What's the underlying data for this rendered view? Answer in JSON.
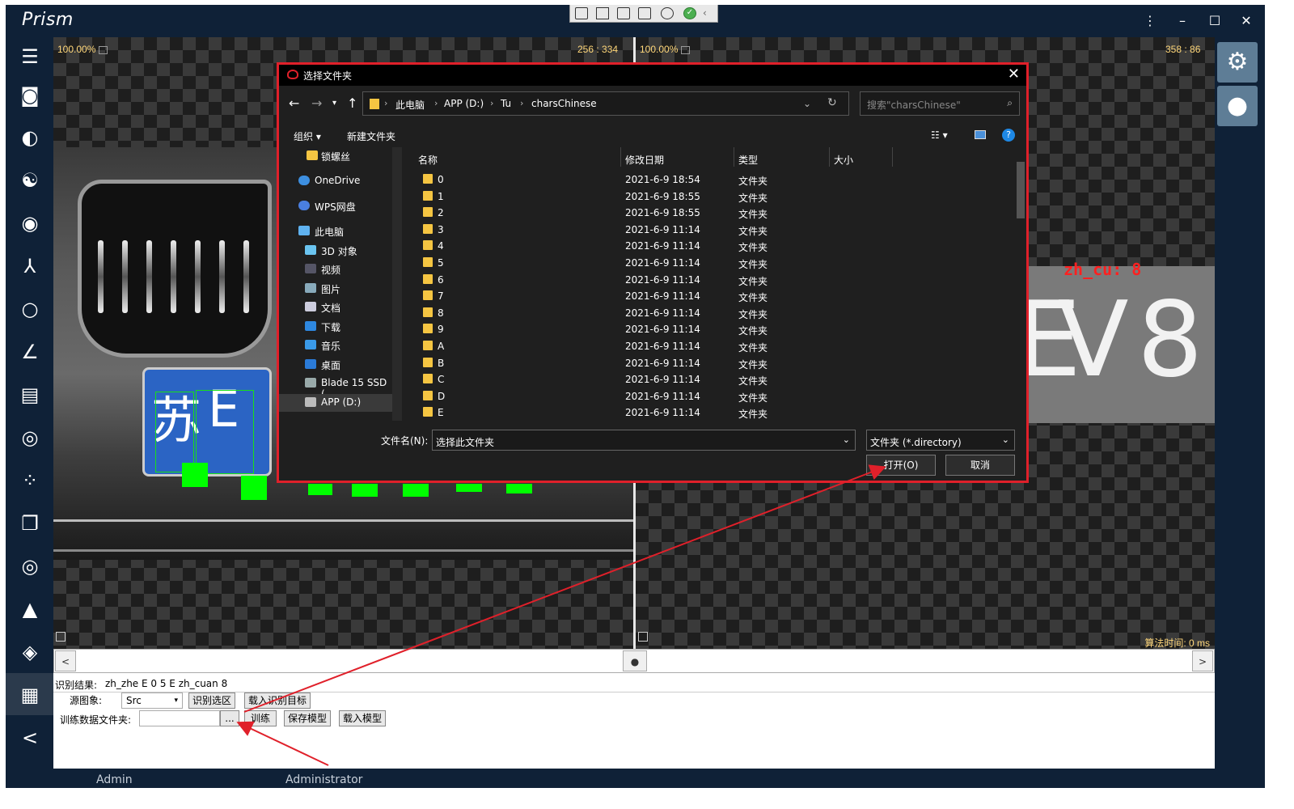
{
  "app": {
    "title": "Prism"
  },
  "viewer": {
    "left_zoom": "100.00%",
    "left_coords": "256 : 334",
    "right_zoom": "100.00%",
    "right_coords": "358 : 86",
    "crop_label": "zh_cu: 8",
    "crop_chars": [
      "E",
      "V",
      "8"
    ],
    "plate_chars": [
      "苏",
      "E"
    ],
    "algo_time": "算法时间: 0 ms"
  },
  "bottom": {
    "result_label": "识别结果:",
    "result_value": "zh_zhe E 0 5 E zh_cuan 8",
    "source_label": "源图象:",
    "source_value": "Src",
    "recognize_region": "识别选区",
    "load_target": "载入识别目标",
    "train_folder_label": "训练数据文件夹:",
    "browse": "...",
    "train": "训练",
    "save_model": "保存模型",
    "load_model": "载入模型"
  },
  "status": {
    "user": "Admin",
    "role": "Administrator"
  },
  "dialog": {
    "title": "选择文件夹",
    "path": [
      "此电脑",
      "APP (D:)",
      "Tu",
      "charsChinese"
    ],
    "search_placeholder": "搜索\"charsChinese\"",
    "organize": "组织",
    "new_folder": "新建文件夹",
    "nav_items": [
      {
        "label": "锁螺丝",
        "icon": "folder-icon"
      },
      {
        "label": "OneDrive",
        "icon": "cloud-icon"
      },
      {
        "label": "WPS网盘",
        "icon": "cloud-icon"
      },
      {
        "label": "此电脑",
        "icon": "computer-icon"
      },
      {
        "label": "3D 对象",
        "icon": "cube-icon"
      },
      {
        "label": "视频",
        "icon": "video-icon"
      },
      {
        "label": "图片",
        "icon": "picture-icon"
      },
      {
        "label": "文档",
        "icon": "document-icon"
      },
      {
        "label": "下载",
        "icon": "download-icon"
      },
      {
        "label": "音乐",
        "icon": "music-icon"
      },
      {
        "label": "桌面",
        "icon": "desktop-icon"
      },
      {
        "label": "Blade 15 SSD (",
        "icon": "drive-icon"
      },
      {
        "label": "APP (D:)",
        "icon": "drive-icon"
      }
    ],
    "columns": [
      "名称",
      "修改日期",
      "类型",
      "大小"
    ],
    "files": [
      {
        "name": "0",
        "date": "2021-6-9 18:54",
        "type": "文件夹"
      },
      {
        "name": "1",
        "date": "2021-6-9 18:55",
        "type": "文件夹"
      },
      {
        "name": "2",
        "date": "2021-6-9 18:55",
        "type": "文件夹"
      },
      {
        "name": "3",
        "date": "2021-6-9 11:14",
        "type": "文件夹"
      },
      {
        "name": "4",
        "date": "2021-6-9 11:14",
        "type": "文件夹"
      },
      {
        "name": "5",
        "date": "2021-6-9 11:14",
        "type": "文件夹"
      },
      {
        "name": "6",
        "date": "2021-6-9 11:14",
        "type": "文件夹"
      },
      {
        "name": "7",
        "date": "2021-6-9 11:14",
        "type": "文件夹"
      },
      {
        "name": "8",
        "date": "2021-6-9 11:14",
        "type": "文件夹"
      },
      {
        "name": "9",
        "date": "2021-6-9 11:14",
        "type": "文件夹"
      },
      {
        "name": "A",
        "date": "2021-6-9 11:14",
        "type": "文件夹"
      },
      {
        "name": "B",
        "date": "2021-6-9 11:14",
        "type": "文件夹"
      },
      {
        "name": "C",
        "date": "2021-6-9 11:14",
        "type": "文件夹"
      },
      {
        "name": "D",
        "date": "2021-6-9 11:14",
        "type": "文件夹"
      },
      {
        "name": "E",
        "date": "2021-6-9 11:14",
        "type": "文件夹"
      }
    ],
    "filename_label": "文件名(N):",
    "filename_value": "选择此文件夹",
    "filter_value": "文件夹 (*.directory)",
    "open": "打开(O)",
    "cancel": "取消"
  },
  "colors": {
    "accent_red": "#e0202a",
    "app_bg": "#0f2137",
    "highlight_green": "#00ff00"
  }
}
